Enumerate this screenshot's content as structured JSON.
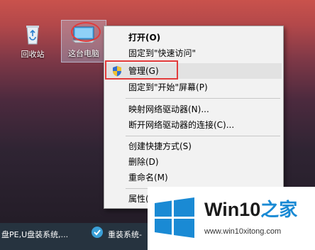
{
  "desktop": {
    "recycle_bin_label": "回收站",
    "this_pc_label": "这台电脑"
  },
  "context_menu": {
    "items": [
      {
        "label": "打开(O)",
        "bold": true
      },
      {
        "label": "固定到\"快速访问\""
      },
      {
        "label": "管理(G)",
        "icon": "uac-shield-icon",
        "highlighted": true
      },
      {
        "label": "固定到\"开始\"屏幕(P)"
      },
      {
        "label": "映射网络驱动器(N)..."
      },
      {
        "label": "断开网络驱动器的连接(C)..."
      },
      {
        "label": "创建快捷方式(S)"
      },
      {
        "label": "删除(D)"
      },
      {
        "label": "重命名(M)"
      },
      {
        "label": "属性(R)"
      }
    ]
  },
  "taskbar": {
    "item1_label": "盘PE,U盘装系统,...",
    "item2_label": "重装系统-"
  },
  "watermark": {
    "title_main": "Win10",
    "title_zh": "之家",
    "url": "www.win10xitong.com"
  },
  "colors": {
    "annotation_red": "#e23b3b",
    "menu_background": "#f2f2f2",
    "taskbar": "#26333f",
    "win_blue": "#1a8ad4"
  }
}
